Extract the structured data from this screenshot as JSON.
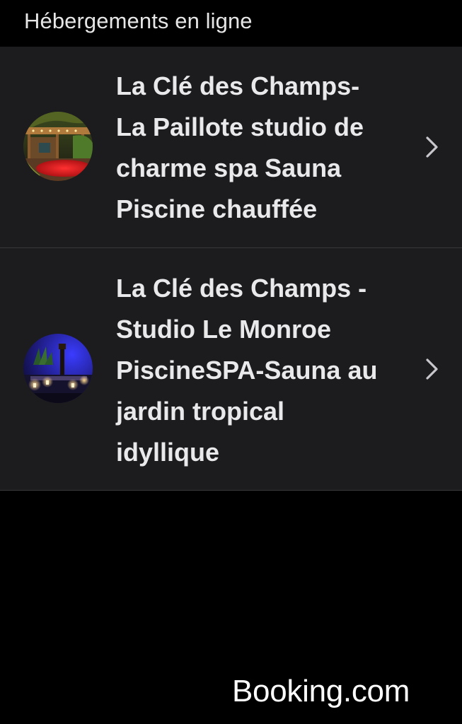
{
  "header": {
    "title": "Hébergements en ligne"
  },
  "listings": [
    {
      "label": "La Clé des Champs-\nLa Paillote studio de\ncharme spa Sauna\nPiscine chauffée",
      "thumbnail_icon": "listing-photo-icon"
    },
    {
      "label": "La Clé des Champs -\nStudio Le Monroe\nPiscineSPA-Sauna au\njardin tropical\nidyllique",
      "thumbnail_icon": "listing-photo-icon"
    }
  ],
  "footer": {
    "brand": "Booking.com"
  },
  "colors": {
    "background": "#000000",
    "row_background": "#1c1c1e",
    "separator": "#38383a",
    "text": "#e9e9eb",
    "chevron": "#c7c7cc"
  }
}
